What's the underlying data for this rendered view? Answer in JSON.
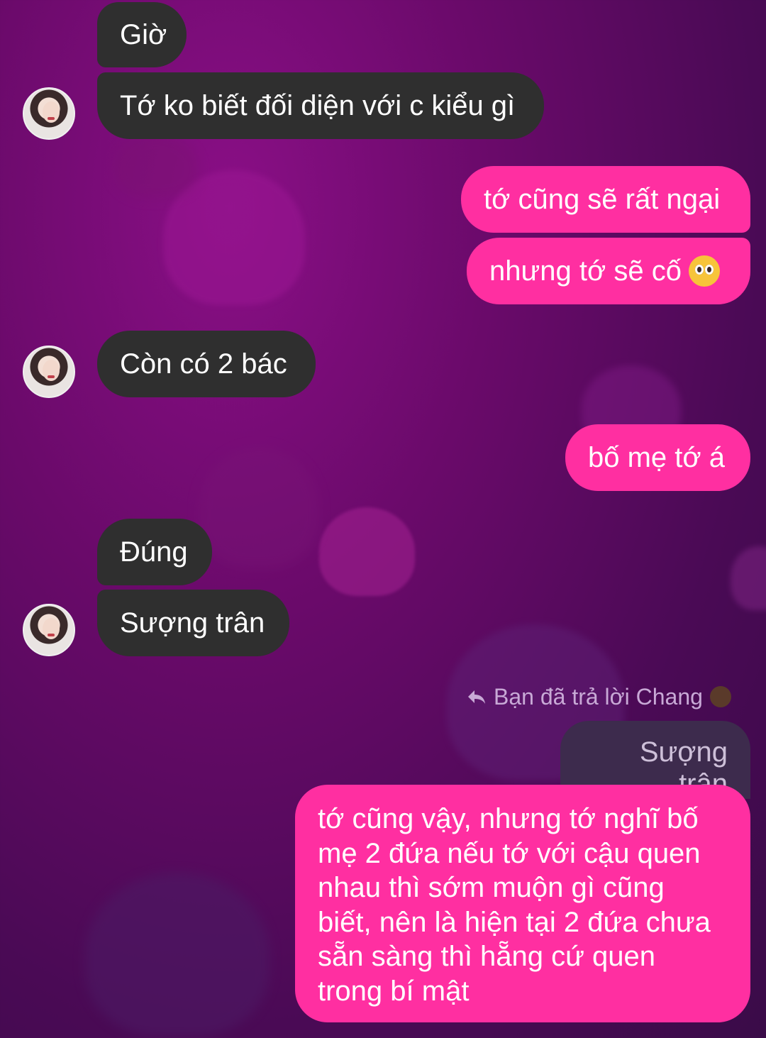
{
  "messages": [
    {
      "side": "in",
      "text": "Giờ"
    },
    {
      "side": "in",
      "text": "Tớ ko biết đối diện với c kiểu gì"
    },
    {
      "side": "out",
      "text": "tớ cũng sẽ rất ngại"
    },
    {
      "side": "out",
      "text": "nhưng tớ sẽ cố"
    },
    {
      "side": "in",
      "text": "Còn có 2 bác"
    },
    {
      "side": "out",
      "text": "bố mẹ tớ á"
    },
    {
      "side": "in",
      "text": "Đúng"
    },
    {
      "side": "in",
      "text": "Sượng trân"
    }
  ],
  "reply": {
    "label": "Bạn đã trả lời Chang",
    "quoted": "Sượng trân",
    "lines": [
      "tớ cũng vậy, nhưng tớ nghĩ bố",
      "mẹ 2 đứa nếu tớ với cậu quen",
      "nhau thì sớm muộn gì cũng",
      "biết, nên là hiện tại 2 đứa chưa",
      "sẵn sàng thì hẵng cứ quen",
      "trong bí mật"
    ]
  },
  "icons": {
    "reply_icon": "reply-arrow-icon",
    "emoji_1": "pleading-face-emoji",
    "emoji_2": "person-emoji"
  },
  "colors": {
    "incoming_bubble": "#2f2f2f",
    "outgoing_bubble": "#ff2fa1",
    "background": "#6a0a6a"
  }
}
